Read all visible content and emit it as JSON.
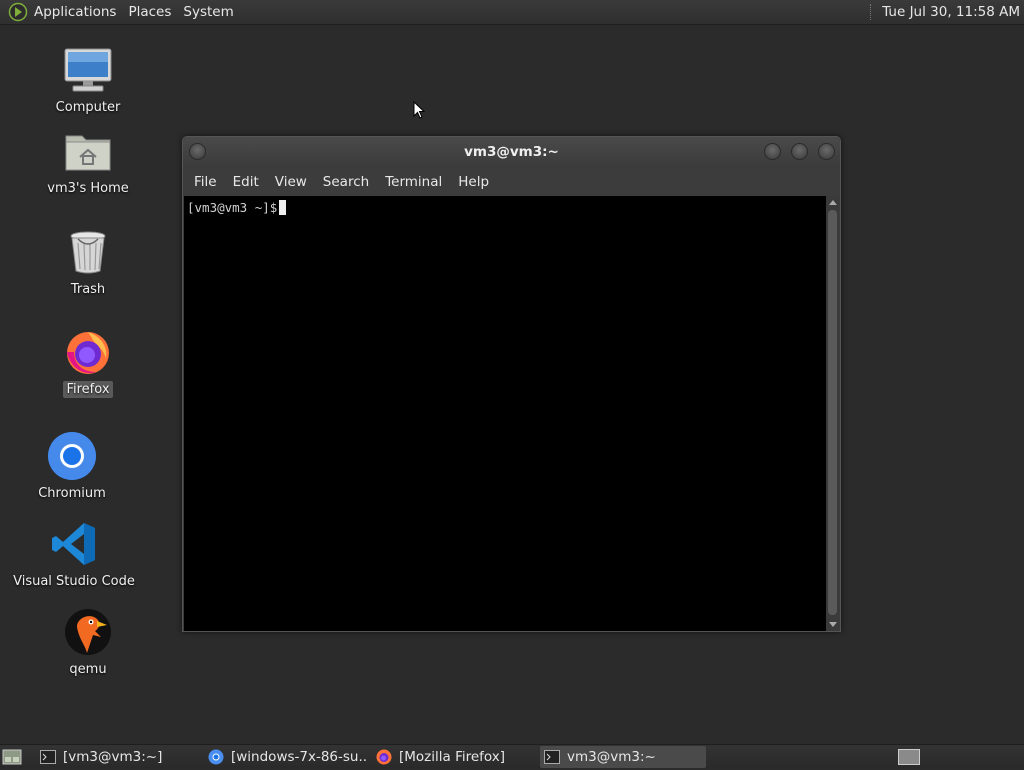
{
  "top_panel": {
    "menus": [
      "Applications",
      "Places",
      "System"
    ],
    "clock": "Tue Jul 30, 11:58 AM"
  },
  "desktop": {
    "icons": [
      {
        "label": "Computer",
        "icon": "computer-icon"
      },
      {
        "label": "vm3's Home",
        "icon": "home-folder-icon"
      },
      {
        "label": "Trash",
        "icon": "trash-icon"
      },
      {
        "label": "Firefox",
        "icon": "firefox-icon",
        "selected": true
      },
      {
        "label": "Chromium",
        "icon": "chromium-icon"
      },
      {
        "label": "Visual Studio Code",
        "icon": "vscode-icon"
      },
      {
        "label": "qemu",
        "icon": "qemu-icon"
      }
    ]
  },
  "terminal": {
    "title": "vm3@vm3:~",
    "menu": [
      "File",
      "Edit",
      "View",
      "Search",
      "Terminal",
      "Help"
    ],
    "prompt": "[vm3@vm3 ~]$"
  },
  "taskbar": {
    "tasks": [
      {
        "label": "[vm3@vm3:~]",
        "icon": "terminal-icon",
        "active": false
      },
      {
        "label": "[windows-7x-86-su...",
        "icon": "chromium-icon",
        "active": false
      },
      {
        "label": "[Mozilla Firefox]",
        "icon": "firefox-icon",
        "active": false
      },
      {
        "label": "vm3@vm3:~",
        "icon": "terminal-icon",
        "active": true
      }
    ]
  },
  "colors": {
    "desktop_bg": "#2b2b2b",
    "panel_bg": "#333333",
    "terminal_bg": "#000000",
    "firefox_orange": "#ff7139",
    "chromium_blue": "#4a8ef0",
    "vscode_blue": "#1e88d8"
  }
}
